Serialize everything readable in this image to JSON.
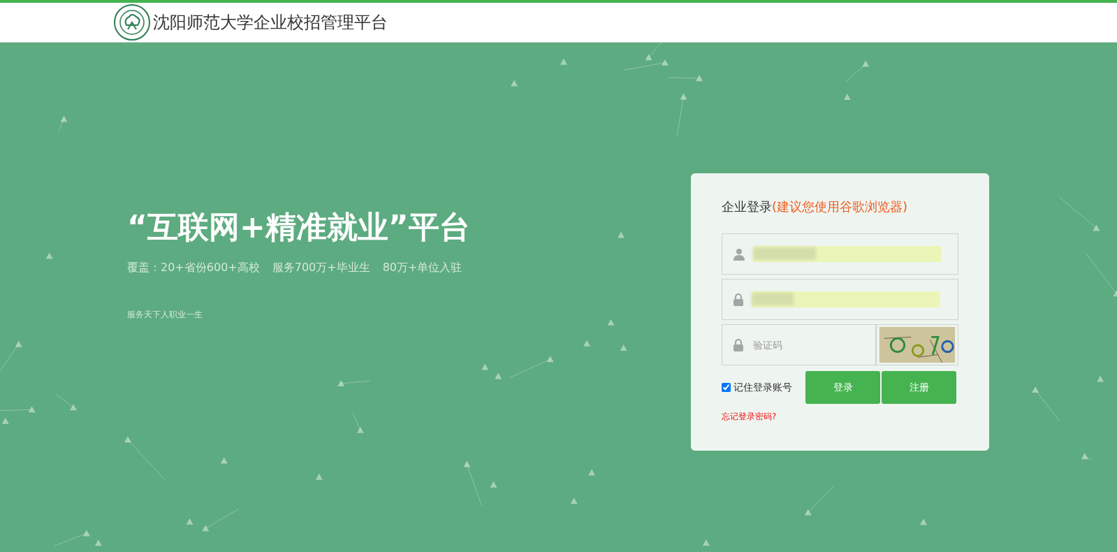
{
  "header": {
    "title": "沈阳师范大学企业校招管理平台"
  },
  "hero": {
    "headline": "“互联网+精准就业”平台",
    "stats": [
      "覆盖：20+省份600+高校",
      "服务700万+毕业生",
      "80万+单位入驻"
    ],
    "tagline": "服务天下人职业一生"
  },
  "login": {
    "title": "企业登录",
    "notice": "(建议您使用谷歌浏览器)",
    "fields": [
      {
        "kind": "username",
        "autofilled": true
      },
      {
        "kind": "password",
        "autofilled": true
      },
      {
        "kind": "captcha",
        "placeholder": "验证码"
      }
    ],
    "remember": {
      "label": "记住登录账号",
      "checked": true
    },
    "buttons": [
      "登录",
      "注册"
    ],
    "forgot_link": "忘记登录密码?"
  }
}
